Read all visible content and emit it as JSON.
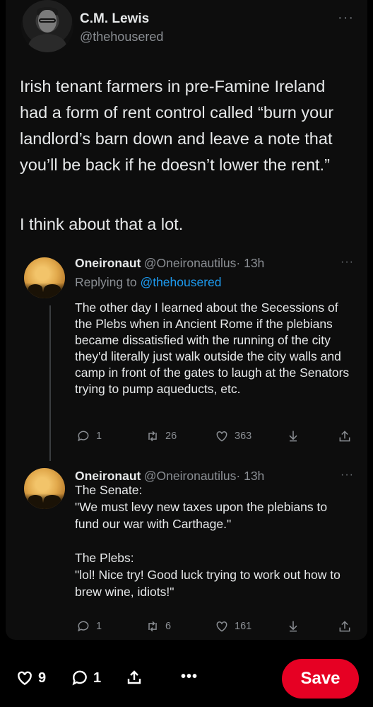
{
  "tweet": {
    "author_name": "C.M. Lewis",
    "author_handle": "@thehousered",
    "text_p1": "Irish tenant farmers in pre-Famine Ireland had a form of rent control called “burn your landlord’s barn down and leave a note that you’ll be back if he doesn’t lower the rent.”",
    "text_p2": "I think about that a lot."
  },
  "reply1": {
    "name": "Oneironaut",
    "handle": "@Oneironautilus",
    "time": "· 13h",
    "replying_prefix": "Replying to",
    "replying_handle": "@thehousered",
    "text": "The other day I learned about the Secessions of the Plebs when in Ancient Rome if the plebians became dissatisfied with the running of the city they'd literally just walk outside the city walls and camp in front of the gates to laugh at the Senators trying to pump aqueducts, etc.",
    "replies": "1",
    "retweets": "26",
    "likes": "363"
  },
  "reply2": {
    "name": "Oneironaut",
    "handle": "@Oneironautilus",
    "time": "· 13h",
    "text": "The Senate:\n\"We must levy new taxes upon the plebians to fund our war with Carthage.\"\n\nThe Plebs:\n\"lol! Nice try! Good luck trying to work out how to brew wine, idiots!\"",
    "replies": "1",
    "retweets": "6",
    "likes": "161"
  },
  "bottom_bar": {
    "likes": "9",
    "comments": "1",
    "more": "•••",
    "save": "Save"
  },
  "colors": {
    "background": "#000000",
    "card": "#0d0d0d",
    "link": "#1d9bf0",
    "save": "#e60023",
    "muted": "#8b8f94"
  }
}
